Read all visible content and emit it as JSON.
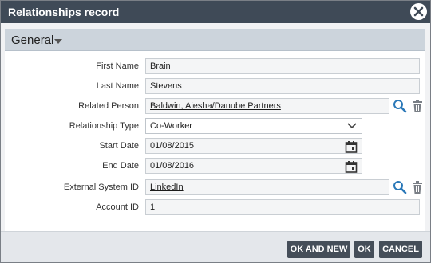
{
  "dialog": {
    "title": "Relationships record"
  },
  "section": {
    "title": "General"
  },
  "fields": {
    "first_name": {
      "label": "First Name",
      "value": "Brain"
    },
    "last_name": {
      "label": "Last Name",
      "value": "Stevens"
    },
    "related_person": {
      "label": "Related Person",
      "value": "Baldwin, Aiesha/Danube Partners"
    },
    "relationship_type": {
      "label": "Relationship Type",
      "value": "Co-Worker"
    },
    "start_date": {
      "label": "Start Date",
      "value": "01/08/2015"
    },
    "end_date": {
      "label": "End Date",
      "value": "01/08/2016"
    },
    "external_system_id": {
      "label": "External System ID",
      "value": "LinkedIn"
    },
    "account_id": {
      "label": "Account ID",
      "value": "1"
    }
  },
  "buttons": {
    "ok_and_new": "OK AND NEW",
    "ok": "OK",
    "cancel": "CANCEL"
  },
  "icons": {
    "close": "close-icon",
    "caret": "caret-down-icon",
    "search": "search-icon",
    "delete": "trash-icon",
    "calendar": "calendar-icon",
    "chevron": "chevron-down-icon"
  },
  "colors": {
    "titlebar": "#3f4a57",
    "section_header": "#ccd4dc",
    "button": "#454e59",
    "search_icon": "#2a78b8",
    "trash_icon": "#7a7f86"
  }
}
